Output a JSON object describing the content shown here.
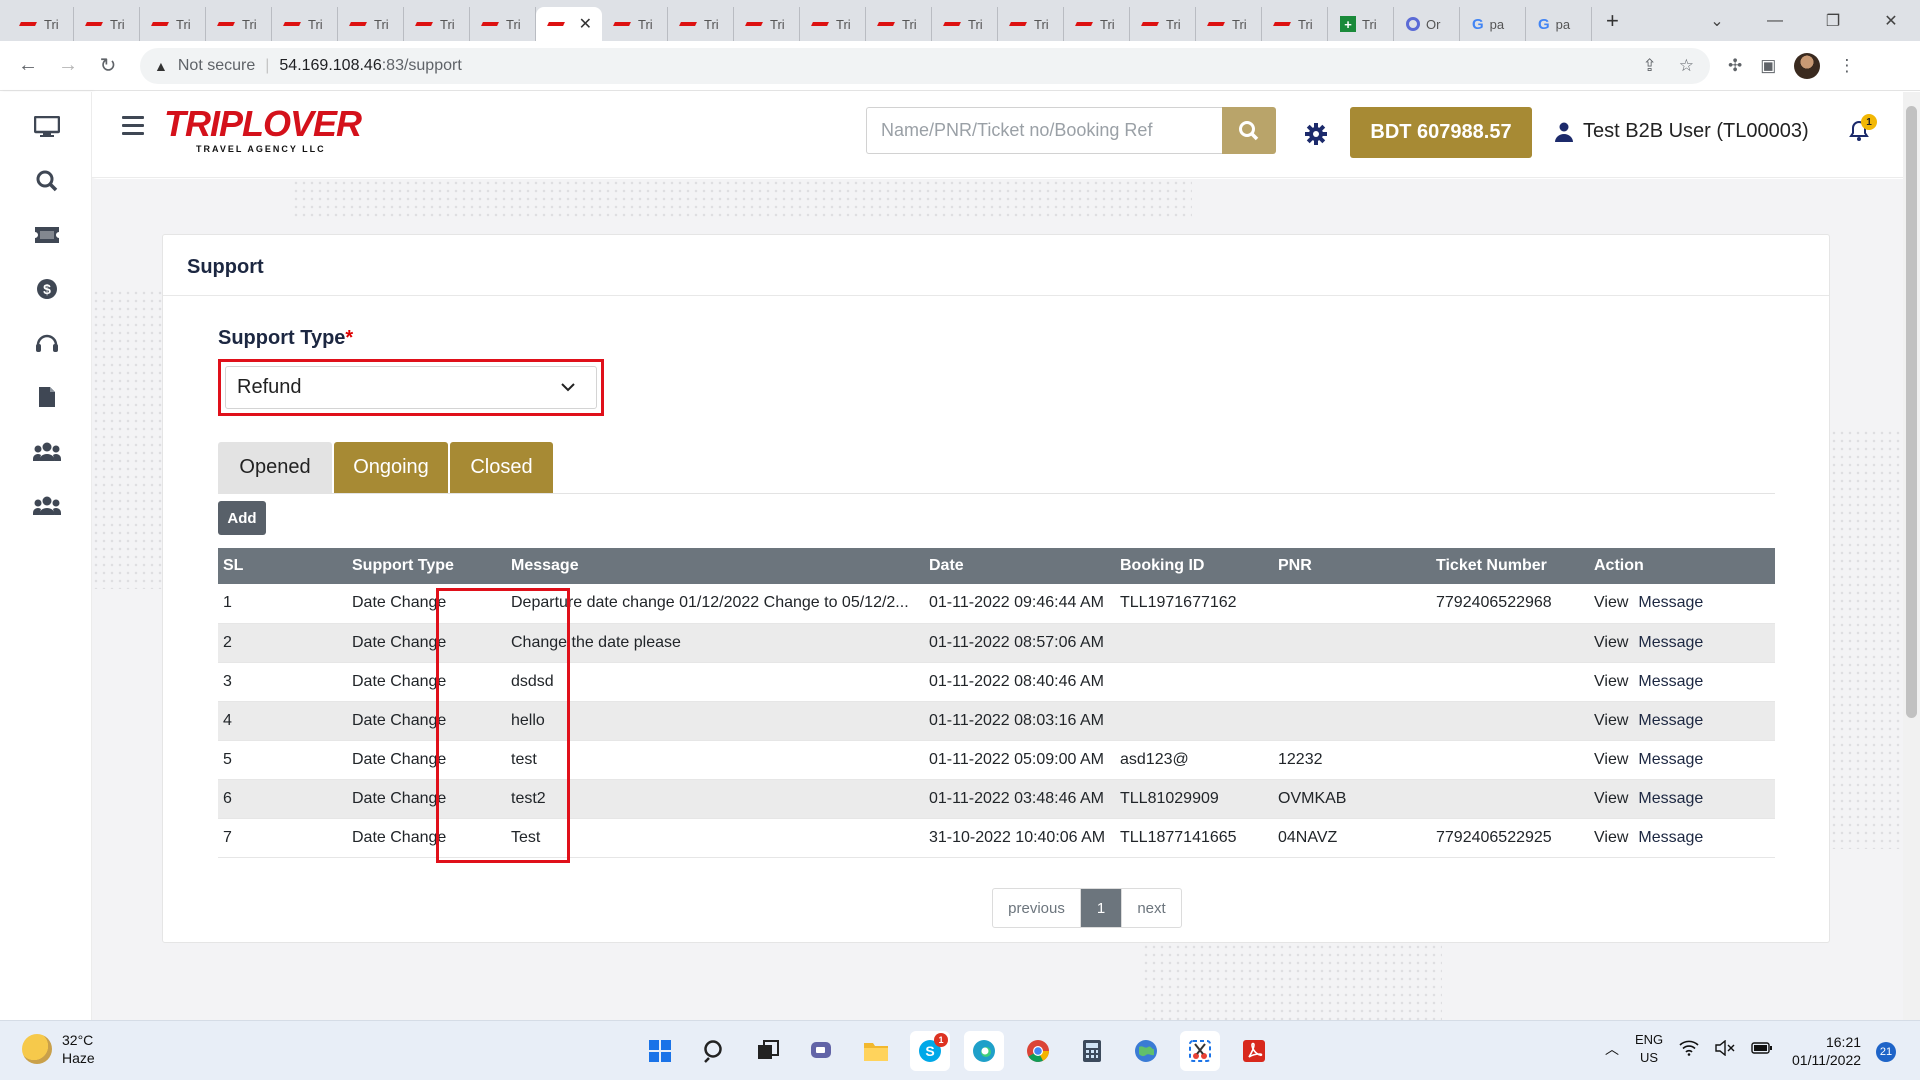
{
  "browser": {
    "tabs": [
      {
        "label": "Tri",
        "icon": "triplover-favicon-icon"
      },
      {
        "label": "Tri",
        "icon": "triplover-favicon-icon"
      },
      {
        "label": "Tri",
        "icon": "triplover-favicon-icon"
      },
      {
        "label": "Tri",
        "icon": "triplover-favicon-icon"
      },
      {
        "label": "Tri",
        "icon": "triplover-favicon-icon"
      },
      {
        "label": "Tri",
        "icon": "triplover-favicon-icon"
      },
      {
        "label": "Tri",
        "icon": "triplover-favicon-icon"
      },
      {
        "label": "Tri",
        "icon": "triplover-favicon-icon"
      },
      {
        "label": "",
        "icon": "triplover-favicon-icon",
        "active": true
      },
      {
        "label": "Tri",
        "icon": "triplover-favicon-icon"
      },
      {
        "label": "Tri",
        "icon": "triplover-favicon-icon"
      },
      {
        "label": "Tri",
        "icon": "triplover-favicon-icon"
      },
      {
        "label": "Tri",
        "icon": "triplover-favicon-icon"
      },
      {
        "label": "Tri",
        "icon": "triplover-favicon-icon"
      },
      {
        "label": "Tri",
        "icon": "triplover-favicon-icon"
      },
      {
        "label": "Tri",
        "icon": "triplover-favicon-icon"
      },
      {
        "label": "Tri",
        "icon": "triplover-favicon-icon"
      },
      {
        "label": "Tri",
        "icon": "triplover-favicon-icon"
      },
      {
        "label": "Tri",
        "icon": "triplover-favicon-icon"
      },
      {
        "label": "Tri",
        "icon": "triplover-favicon-icon"
      },
      {
        "label": "Tri",
        "icon": "sheets-icon"
      },
      {
        "label": "Or",
        "icon": "ring-icon"
      },
      {
        "label": "pa",
        "icon": "google-icon"
      },
      {
        "label": "pa",
        "icon": "google-icon"
      }
    ],
    "address": {
      "security": "Not secure",
      "host": "54.169.108.46",
      "path": ":83/support"
    }
  },
  "sidebar": {
    "items": [
      {
        "name": "dashboard-monitor-icon"
      },
      {
        "name": "search-icon"
      },
      {
        "name": "ticket-icon"
      },
      {
        "name": "money-icon"
      },
      {
        "name": "headset-support-icon"
      },
      {
        "name": "document-icon"
      },
      {
        "name": "users-group-icon"
      },
      {
        "name": "users-group-icon"
      }
    ]
  },
  "header": {
    "logo_text": "TRIPLOVER",
    "logo_sub": "TRAVEL AGENCY LLC",
    "search_placeholder": "Name/PNR/Ticket no/Booking Ref",
    "balance": "BDT 607988.57",
    "user": "Test B2B User (TL00003)",
    "notification_count": "1"
  },
  "support": {
    "title": "Support",
    "type_label": "Support Type",
    "required_mark": "*",
    "type_value": "Refund",
    "tabs": [
      "Opened",
      "Ongoing",
      "Closed"
    ],
    "add_label": "Add",
    "columns": [
      "SL",
      "Support Type",
      "Message",
      "Date",
      "Booking ID",
      "PNR",
      "Ticket Number",
      "Action"
    ],
    "rows": [
      {
        "sl": "1",
        "type": "Date Change",
        "message": "Departure date change 01/12/2022 Change to 05/12/2...",
        "date": "01-11-2022 09:46:44 AM",
        "booking": "TLL1971677162",
        "pnr": "",
        "ticket": "7792406522968",
        "view": "View",
        "msg": "Message"
      },
      {
        "sl": "2",
        "type": "Date Change",
        "message": "Change the date please",
        "date": "01-11-2022 08:57:06 AM",
        "booking": "",
        "pnr": "",
        "ticket": "",
        "view": "View",
        "msg": "Message"
      },
      {
        "sl": "3",
        "type": "Date Change",
        "message": "dsdsd",
        "date": "01-11-2022 08:40:46 AM",
        "booking": "",
        "pnr": "",
        "ticket": "",
        "view": "View",
        "msg": "Message"
      },
      {
        "sl": "4",
        "type": "Date Change",
        "message": "hello",
        "date": "01-11-2022 08:03:16 AM",
        "booking": "",
        "pnr": "",
        "ticket": "",
        "view": "View",
        "msg": "Message"
      },
      {
        "sl": "5",
        "type": "Date Change",
        "message": "test",
        "date": "01-11-2022 05:09:00 AM",
        "booking": "asd123@",
        "pnr": "12232",
        "ticket": "",
        "view": "View",
        "msg": "Message"
      },
      {
        "sl": "6",
        "type": "Date Change",
        "message": "test2",
        "date": "01-11-2022 03:48:46 AM",
        "booking": "TLL81029909",
        "pnr": "OVMKAB",
        "ticket": "",
        "view": "View",
        "msg": "Message"
      },
      {
        "sl": "7",
        "type": "Date Change",
        "message": "Test",
        "date": "31-10-2022 10:40:06 AM",
        "booking": "TLL1877141665",
        "pnr": "04NAVZ",
        "ticket": "7792406522925",
        "view": "View",
        "msg": "Message"
      }
    ],
    "pagination": {
      "previous": "previous",
      "current": "1",
      "next": "next"
    }
  },
  "taskbar": {
    "weather_temp": "32°C",
    "weather_desc": "Haze",
    "skype_badge": "1",
    "lang": "ENG",
    "region": "US",
    "time": "16:21",
    "date": "01/11/2022",
    "notification_count": "21"
  },
  "colors": {
    "brand_red": "#d4111b",
    "gold": "#a78a34",
    "table_header": "#6c757d",
    "highlight_red": "#e0101a"
  }
}
